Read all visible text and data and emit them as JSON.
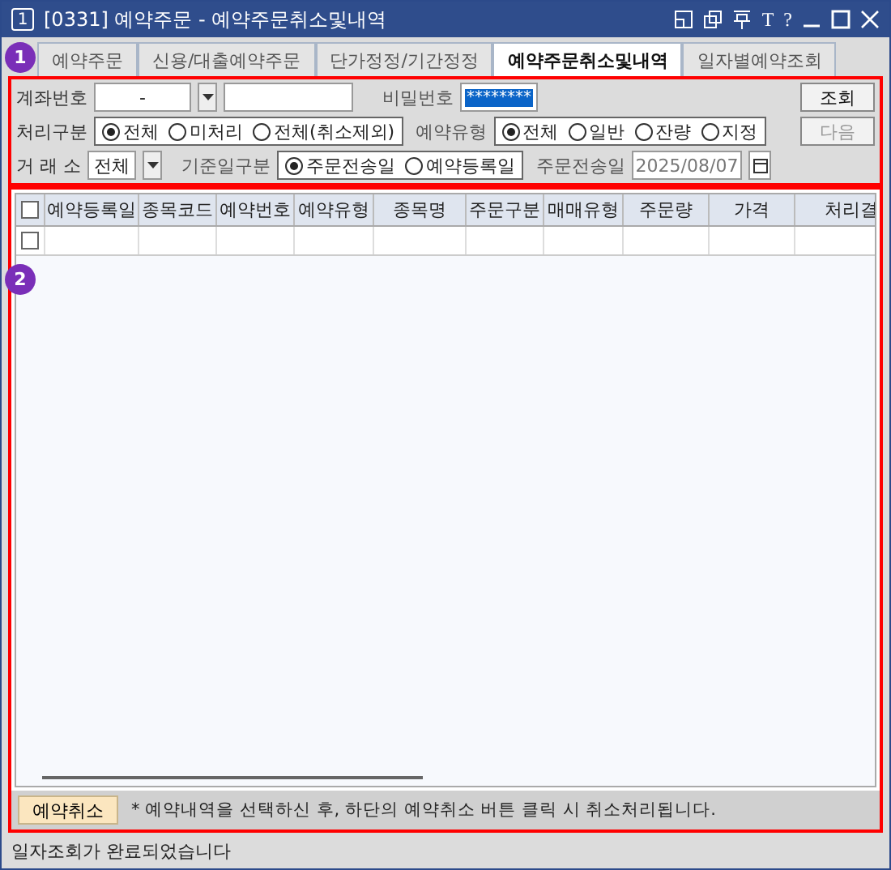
{
  "window": {
    "title": "[0331] 예약주문 - 예약주문취소및내역",
    "number": "1",
    "controls": [
      "T",
      "?"
    ]
  },
  "tabs": [
    {
      "label": "예약주문",
      "selected": false
    },
    {
      "label": "신용/대출예약주문",
      "selected": false
    },
    {
      "label": "단가정정/기간정정",
      "selected": false
    },
    {
      "label": "예약주문취소및내역",
      "selected": true
    },
    {
      "label": "일자별예약조회",
      "selected": false
    }
  ],
  "markers": [
    "1",
    "2"
  ],
  "form": {
    "account_label": "계좌번호",
    "account_value": "-",
    "password_label": "비밀번호",
    "password_value": "********",
    "process_label": "처리구분",
    "process_options": [
      {
        "label": "전체",
        "selected": true
      },
      {
        "label": "미처리",
        "selected": false
      },
      {
        "label": "전체(취소제외)",
        "selected": false
      }
    ],
    "type_label": "예약유형",
    "type_options": [
      {
        "label": "전체",
        "selected": true
      },
      {
        "label": "일반",
        "selected": false
      },
      {
        "label": "잔량",
        "selected": false
      },
      {
        "label": "지정",
        "selected": false
      }
    ],
    "exchange_label": "거 래 소",
    "exchange_value": "전체",
    "basis_label": "기준일구분",
    "basis_options": [
      {
        "label": "주문전송일",
        "selected": true
      },
      {
        "label": "예약등록일",
        "selected": false
      }
    ],
    "date_label": "주문전송일",
    "date_value": "2025/08/07",
    "buttons": [
      {
        "label": "조회",
        "disabled": false
      },
      {
        "label": "다음",
        "disabled": true
      }
    ]
  },
  "table": {
    "all_checked": false,
    "columns": [
      "예약등록일",
      "종목코드",
      "예약번호",
      "예약유형",
      "종목명",
      "주문구분",
      "매매유형",
      "주문량",
      "가격",
      "처리결"
    ],
    "rows": [
      {
        "checked": false
      }
    ]
  },
  "footer": {
    "button": "예약취소",
    "note": "* 예약내역을 선택하신 후, 하단의 예약취소 버튼 클릭 시 취소처리됩니다."
  },
  "status_bar": "일자조회가 완료되었습니다"
}
